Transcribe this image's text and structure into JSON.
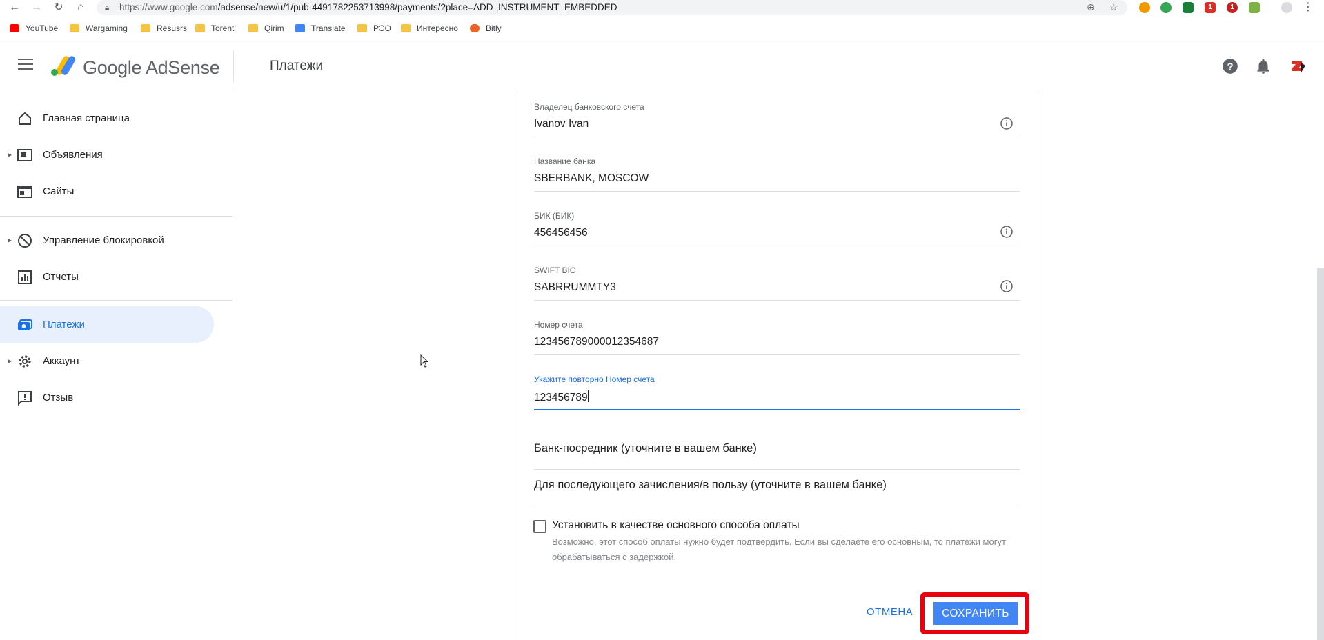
{
  "browser": {
    "url_host": "https://www.google.com",
    "url_path": "/adsense/new/u/1/pub-4491782253713998/payments/?place=ADD_INSTRUMENT_EMBEDDED",
    "bookmarks": [
      {
        "label": "YouTube",
        "icon": "youtube-icon"
      },
      {
        "label": "Wargaming",
        "icon": "folder-icon"
      },
      {
        "label": "Resusrs",
        "icon": "folder-icon"
      },
      {
        "label": "Torent",
        "icon": "folder-icon"
      },
      {
        "label": "Qirim",
        "icon": "folder-icon"
      },
      {
        "label": "Translate",
        "icon": "translate-icon"
      },
      {
        "label": "РЭО",
        "icon": "folder-icon"
      },
      {
        "label": "Интересно",
        "icon": "folder-icon"
      },
      {
        "label": "Bitly",
        "icon": "bitly-icon"
      }
    ],
    "badges": {
      "gmail": "1",
      "ext": "1"
    }
  },
  "app": {
    "brand": "Google AdSense",
    "page_title": "Платежи"
  },
  "sidebar": {
    "items": [
      {
        "label": "Главная страница",
        "icon": "home-icon"
      },
      {
        "label": "Объявления",
        "icon": "ads-icon"
      },
      {
        "label": "Сайты",
        "icon": "sites-icon"
      },
      {
        "label": "Управление блокировкой",
        "icon": "block-icon"
      },
      {
        "label": "Отчеты",
        "icon": "reports-icon"
      },
      {
        "label": "Платежи",
        "icon": "payments-icon"
      },
      {
        "label": "Аккаунт",
        "icon": "gear-icon"
      },
      {
        "label": "Отзыв",
        "icon": "feedback-icon"
      }
    ]
  },
  "form": {
    "owner": {
      "label": "Владелец банковского счета",
      "value": "Ivanov Ivan"
    },
    "bank": {
      "label": "Название банка",
      "value": "SBERBANK, MOSCOW"
    },
    "bik": {
      "label": "БИК (БИК)",
      "value": "456456456"
    },
    "swift": {
      "label": "SWIFT BIC",
      "value": "SABRRUMMTY3"
    },
    "account": {
      "label": "Номер счета",
      "value": "12345678900001235468 7"
    },
    "account_repeat": {
      "label": "Укажите повторно Номер счета",
      "value": "123456789"
    },
    "intermediary": "Банк-посредник (уточните в вашем банке)",
    "further_credit": "Для последующего зачисления/в пользу (уточните в вашем банке)",
    "primary_checkbox": "Установить в качестве основного способа оплаты",
    "primary_hint": "Возможно, этот способ оплаты нужно будет подтвердить. Если вы сделаете его основным, то платежи могут обрабатываться с задержкой.",
    "cancel": "ОТМЕНА",
    "save": "СОХРАНИТЬ"
  },
  "colors": {
    "accent": "#1a73e8",
    "save_button": "#4285f4",
    "highlight": "#e8000d",
    "active_bg": "#e8f0fe"
  }
}
